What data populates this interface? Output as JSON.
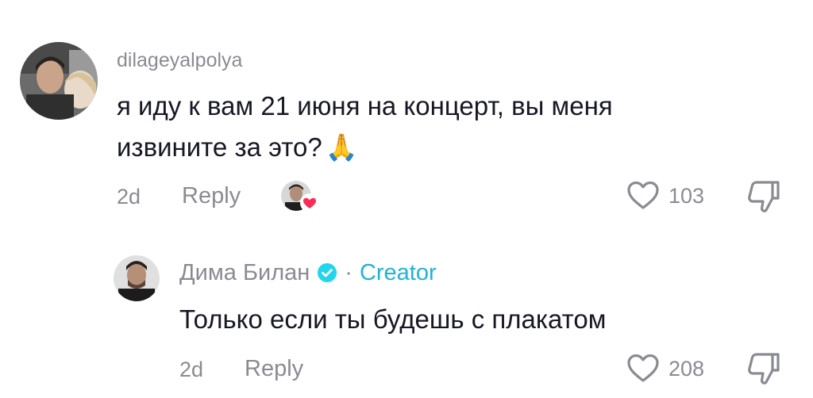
{
  "comment": {
    "username": "dilageyalpolya",
    "text_line1": "я иду к вам 21 июня на концерт, вы меня",
    "text_line2": "извините за это?",
    "emoji": "🙏",
    "age": "2d",
    "reply_label": "Reply",
    "likes": "103",
    "icons": [
      "avatar",
      "creator-liked-avatar",
      "heart-icon",
      "dislike-icon"
    ]
  },
  "reply": {
    "username": "Дима Билан",
    "separator": "·",
    "creator_label": "Creator",
    "text": "Только если ты будешь с плакатом",
    "age": "2d",
    "reply_label": "Reply",
    "likes": "208",
    "icons": [
      "avatar",
      "verified-badge-icon",
      "heart-icon",
      "dislike-icon"
    ]
  },
  "colors": {
    "primary_text": "#161823",
    "secondary_text": "#8a8b91",
    "creator_accent": "#20b3d3",
    "liked_heart": "#fe2c55"
  }
}
